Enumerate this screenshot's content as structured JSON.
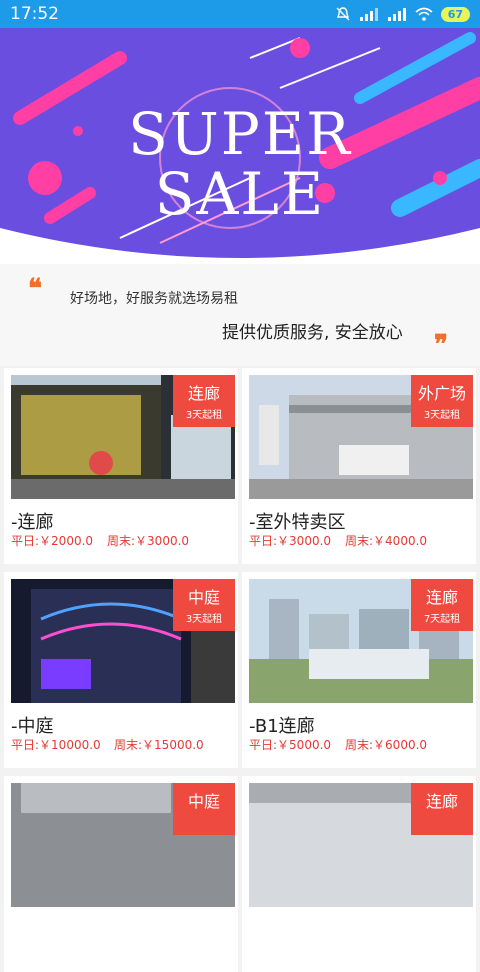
{
  "status": {
    "time": "17:52",
    "battery": "67"
  },
  "banner": {
    "line1": "SUPER",
    "line2": "SALE"
  },
  "slogan": {
    "left_text": "好场地，好服务就选场易租",
    "right_text": "提供优质服务, 安全放心",
    "open_quote": "❝",
    "close_quote": "❞"
  },
  "cards": [
    {
      "tag": "连廊",
      "min_rent": "3天起租",
      "name": "-连廊",
      "weekday": "平日:￥2000.0",
      "weekend": "周末:￥3000.0",
      "photo": "mall-facade-photo"
    },
    {
      "tag": "外广场",
      "min_rent": "3天起租",
      "name": "-室外特卖区",
      "weekday": "平日:￥3000.0",
      "weekend": "周末:￥4000.0",
      "photo": "outdoor-plaza-photo"
    },
    {
      "tag": "中庭",
      "min_rent": "3天起租",
      "name": "-中庭",
      "weekday": "平日:￥10000.0",
      "weekend": "周末:￥15000.0",
      "photo": "night-mall-photo"
    },
    {
      "tag": "连廊",
      "min_rent": "7天起租",
      "name": "-B1连廊",
      "weekday": "平日:￥5000.0",
      "weekend": "周末:￥6000.0",
      "photo": "aerial-complex-photo"
    },
    {
      "tag": "中庭",
      "min_rent": "",
      "name": "",
      "weekday": "",
      "weekend": "",
      "photo": "partial-photo"
    },
    {
      "tag": "连廊",
      "min_rent": "",
      "name": "",
      "weekday": "",
      "weekend": "",
      "photo": "partial-photo"
    }
  ],
  "colors": {
    "status_bar": "#1e9be8",
    "tag_bg": "#ef4a40",
    "price": "#e53935",
    "quote": "#f36f28",
    "banner_bg": "#6a4ee0"
  }
}
